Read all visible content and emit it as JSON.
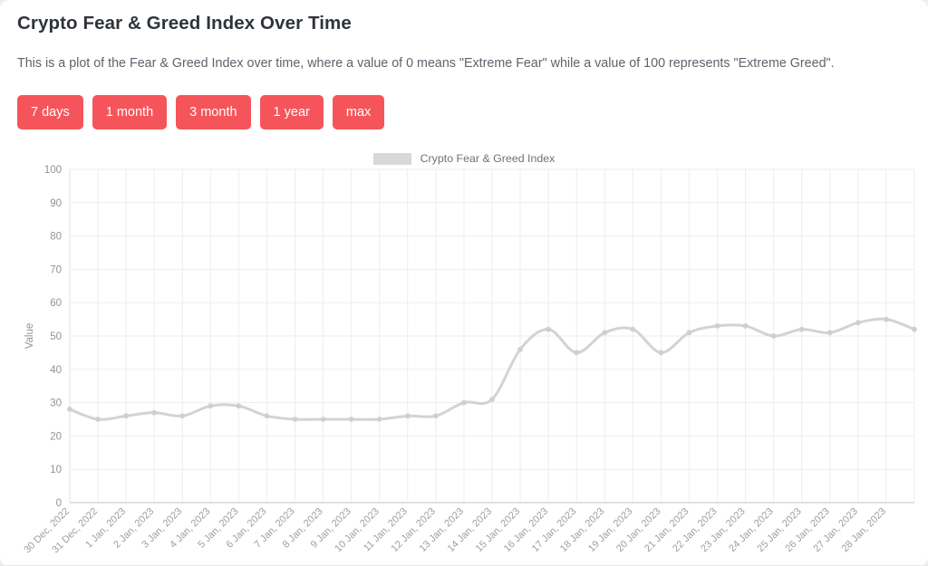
{
  "header": {
    "title": "Crypto Fear & Greed Index Over Time",
    "subtitle": "This is a plot of the Fear & Greed Index over time, where a value of 0 means \"Extreme Fear\" while a value of 100 represents \"Extreme Greed\"."
  },
  "range_buttons": [
    {
      "label": "7 days"
    },
    {
      "label": "1 month"
    },
    {
      "label": "3 month"
    },
    {
      "label": "1 year"
    },
    {
      "label": "max"
    }
  ],
  "colors": {
    "button": "#f5555a",
    "button_text": "#ffffff",
    "line": "#d3d3d3",
    "grid": "#ededed",
    "title_text": "#2f343a",
    "body_text": "#5d646d",
    "tick_text": "#9aa0a5"
  },
  "chart_data": {
    "type": "line",
    "title": "",
    "xlabel": "",
    "ylabel": "Value",
    "ylim": [
      0,
      100
    ],
    "yticks": [
      0,
      10,
      20,
      30,
      40,
      50,
      60,
      70,
      80,
      90,
      100
    ],
    "grid": true,
    "legend_position": "top-center",
    "legend": [
      "Crypto Fear & Greed Index"
    ],
    "categories": [
      "30 Dec, 2022",
      "31 Dec, 2022",
      "1 Jan, 2023",
      "2 Jan, 2023",
      "3 Jan, 2023",
      "4 Jan, 2023",
      "5 Jan, 2023",
      "6 Jan, 2023",
      "7 Jan, 2023",
      "8 Jan, 2023",
      "9 Jan, 2023",
      "10 Jan, 2023",
      "11 Jan, 2023",
      "12 Jan, 2023",
      "13 Jan, 2023",
      "14 Jan, 2023",
      "15 Jan, 2023",
      "16 Jan, 2023",
      "17 Jan, 2023",
      "18 Jan, 2023",
      "19 Jan, 2023",
      "20 Jan, 2023",
      "21 Jan, 2023",
      "22 Jan, 2023",
      "23 Jan, 2023",
      "24 Jan, 2023",
      "25 Jan, 2023",
      "26 Jan, 2023",
      "27 Jan, 2023",
      "28 Jan, 2023"
    ],
    "series": [
      {
        "name": "Crypto Fear & Greed Index",
        "values": [
          28,
          25,
          26,
          27,
          26,
          29,
          29,
          26,
          25,
          25,
          25,
          25,
          26,
          26,
          30,
          31,
          46,
          52,
          45,
          51,
          52,
          45,
          51,
          53,
          53,
          50,
          52,
          51,
          54,
          55,
          52
        ]
      }
    ]
  }
}
